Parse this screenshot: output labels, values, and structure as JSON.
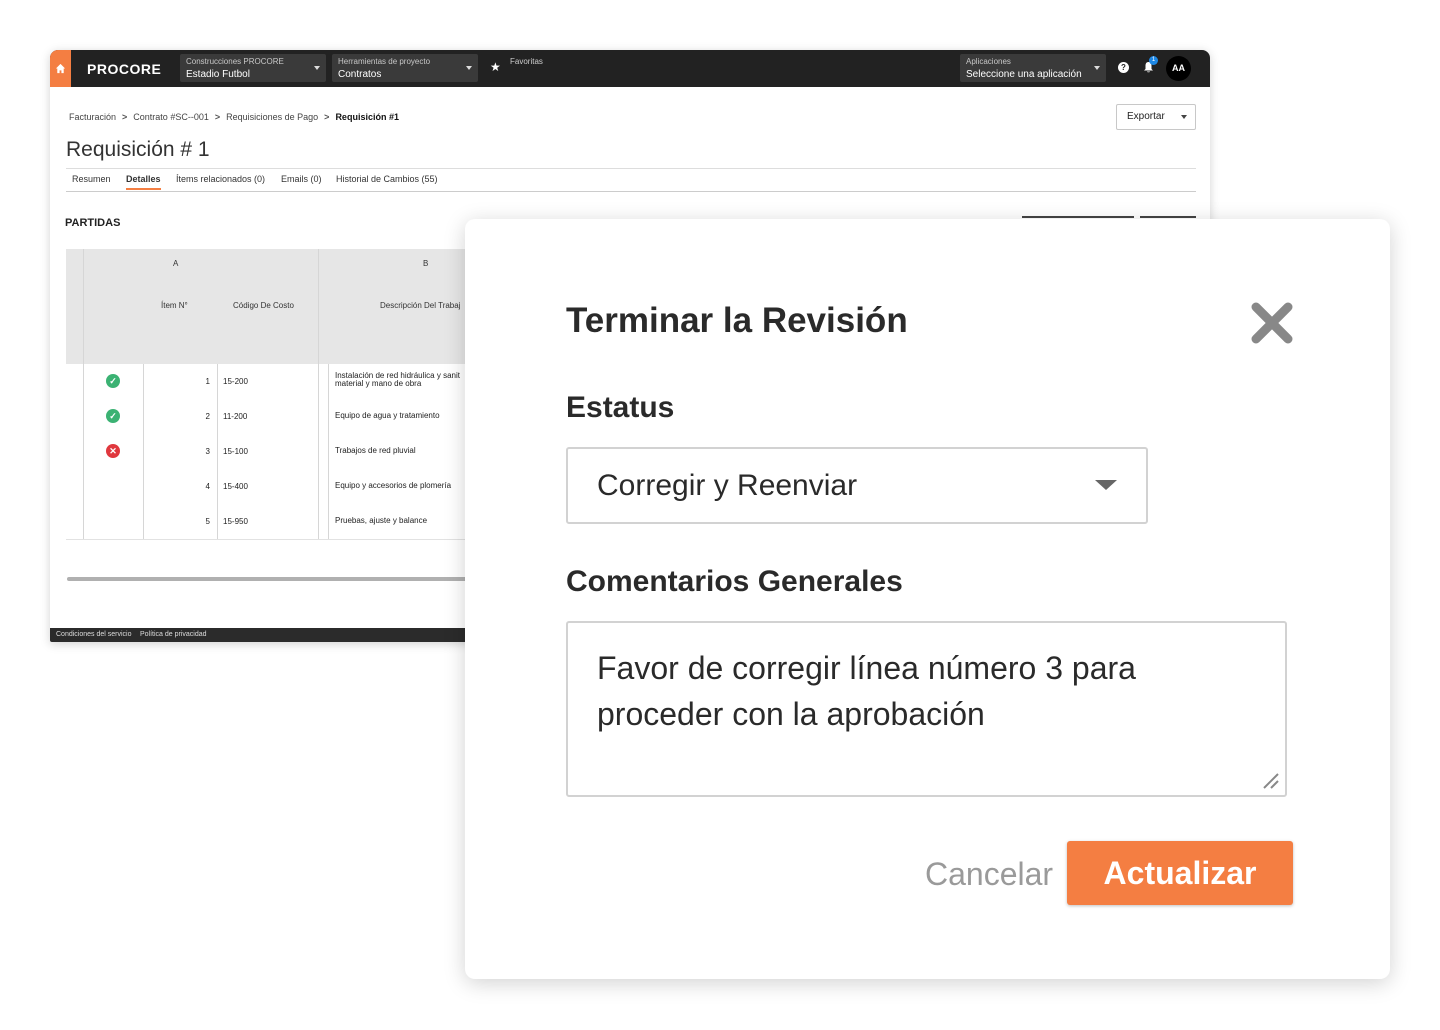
{
  "app": {
    "logo": "PROCORE",
    "company": {
      "label": "Construcciones PROCORE",
      "value": "Estadio Futbol"
    },
    "tools": {
      "label": "Herramientas de proyecto",
      "value": "Contratos"
    },
    "favorites_label": "Favoritas",
    "apps": {
      "label": "Aplicaciones",
      "value": "Seleccione una aplicación"
    },
    "help_glyph": "?",
    "notification_count": "1",
    "avatar_initials": "AA"
  },
  "breadcrumb": {
    "items": [
      "Facturación",
      "Contrato #SC--001",
      "Requisiciones de Pago",
      "Requisición #1"
    ],
    "separator": ">"
  },
  "export_label": "Exportar",
  "page_title": "Requisición # 1",
  "tabs": [
    {
      "label": "Resumen",
      "active": false
    },
    {
      "label": "Detalles",
      "active": true
    },
    {
      "label": "Ítems relacionados (0)",
      "active": false
    },
    {
      "label": "Emails (0)",
      "active": false
    },
    {
      "label": "Historial de Cambios (55)",
      "active": false
    }
  ],
  "section_title": "PARTIDAS",
  "table": {
    "group_headers": [
      "A",
      "B"
    ],
    "headers": [
      "Ítem N°",
      "Código De Costo",
      "Descripción Del Trabaj"
    ],
    "rows": [
      {
        "status": "approved",
        "num": "1",
        "code": "15-200",
        "desc_line1": "Instalación de red hidráulica y sanit",
        "desc_line2": "material y mano de obra"
      },
      {
        "status": "approved",
        "num": "2",
        "code": "11-200",
        "desc_line1": "Equipo de agua y tratamiento",
        "desc_line2": ""
      },
      {
        "status": "rejected",
        "num": "3",
        "code": "15-100",
        "desc_line1": "Trabajos de red pluvial",
        "desc_line2": ""
      },
      {
        "status": "none",
        "num": "4",
        "code": "15-400",
        "desc_line1": "Equipo y accesorios de plomería",
        "desc_line2": ""
      },
      {
        "status": "none",
        "num": "5",
        "code": "15-950",
        "desc_line1": "Pruebas, ajuste y balance",
        "desc_line2": ""
      }
    ]
  },
  "footer": {
    "terms": "Condiciones del servicio",
    "privacy": "Política de privacidad"
  },
  "modal": {
    "title": "Terminar la Revisión",
    "status_label": "Estatus",
    "status_value": "Corregir y Reenviar",
    "comments_label": "Comentarios Generales",
    "comments_value": "Favor de corregir línea número 3 para proceder con la aprobación",
    "cancel_label": "Cancelar",
    "update_label": "Actualizar"
  },
  "colors": {
    "accent": "#f47e42",
    "topbar": "#222222",
    "approved": "#3bb273",
    "rejected": "#e0383e"
  }
}
